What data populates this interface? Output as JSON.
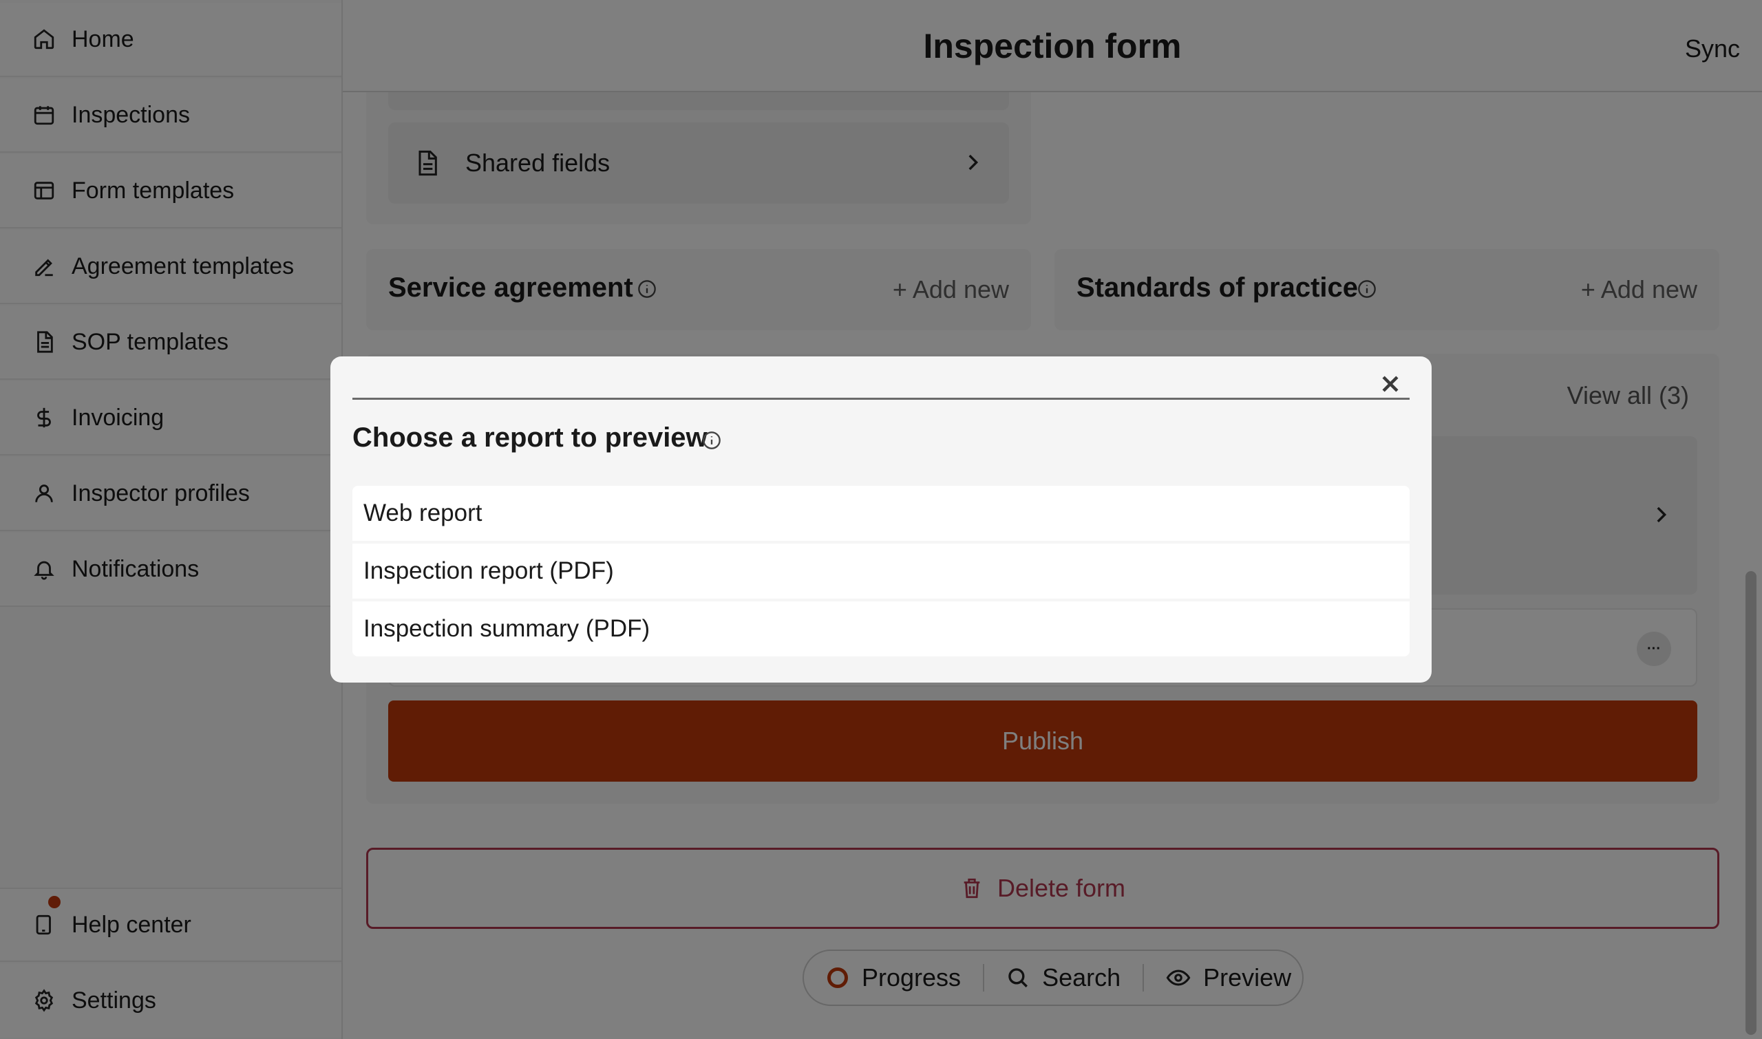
{
  "sidebar": {
    "items": [
      {
        "label": "Home",
        "icon": "home-icon"
      },
      {
        "label": "Inspections",
        "icon": "calendar-icon"
      },
      {
        "label": "Form templates",
        "icon": "layout-icon"
      },
      {
        "label": "Agreement templates",
        "icon": "signature-icon"
      },
      {
        "label": "SOP templates",
        "icon": "document-icon"
      },
      {
        "label": "Invoicing",
        "icon": "dollar-icon"
      },
      {
        "label": "Inspector profiles",
        "icon": "user-icon"
      },
      {
        "label": "Notifications",
        "icon": "bell-icon"
      }
    ],
    "footer": [
      {
        "label": "Help center",
        "icon": "help-device-icon"
      },
      {
        "label": "Settings",
        "icon": "gear-icon"
      }
    ]
  },
  "header": {
    "title": "Inspection form",
    "sync_label": "Sync"
  },
  "main": {
    "shared_fields_label": "Shared fields",
    "service_agreement": {
      "title": "Service agreement",
      "add_label": "+ Add new"
    },
    "standards_of_practice": {
      "title": "Standards of practice",
      "add_label": "+ Add new"
    },
    "view_all_label": "View all (3)",
    "publish_label": "Publish",
    "delete_label": "Delete form"
  },
  "bottom_bar": {
    "progress_label": "Progress",
    "search_label": "Search",
    "preview_label": "Preview"
  },
  "modal": {
    "title": "Choose a report to preview",
    "options": [
      "Web report",
      "Inspection report (PDF)",
      "Inspection summary (PDF)"
    ]
  },
  "colors": {
    "accent": "#c1390b",
    "danger": "#b0364f",
    "notification_dot": "#c0390f"
  }
}
